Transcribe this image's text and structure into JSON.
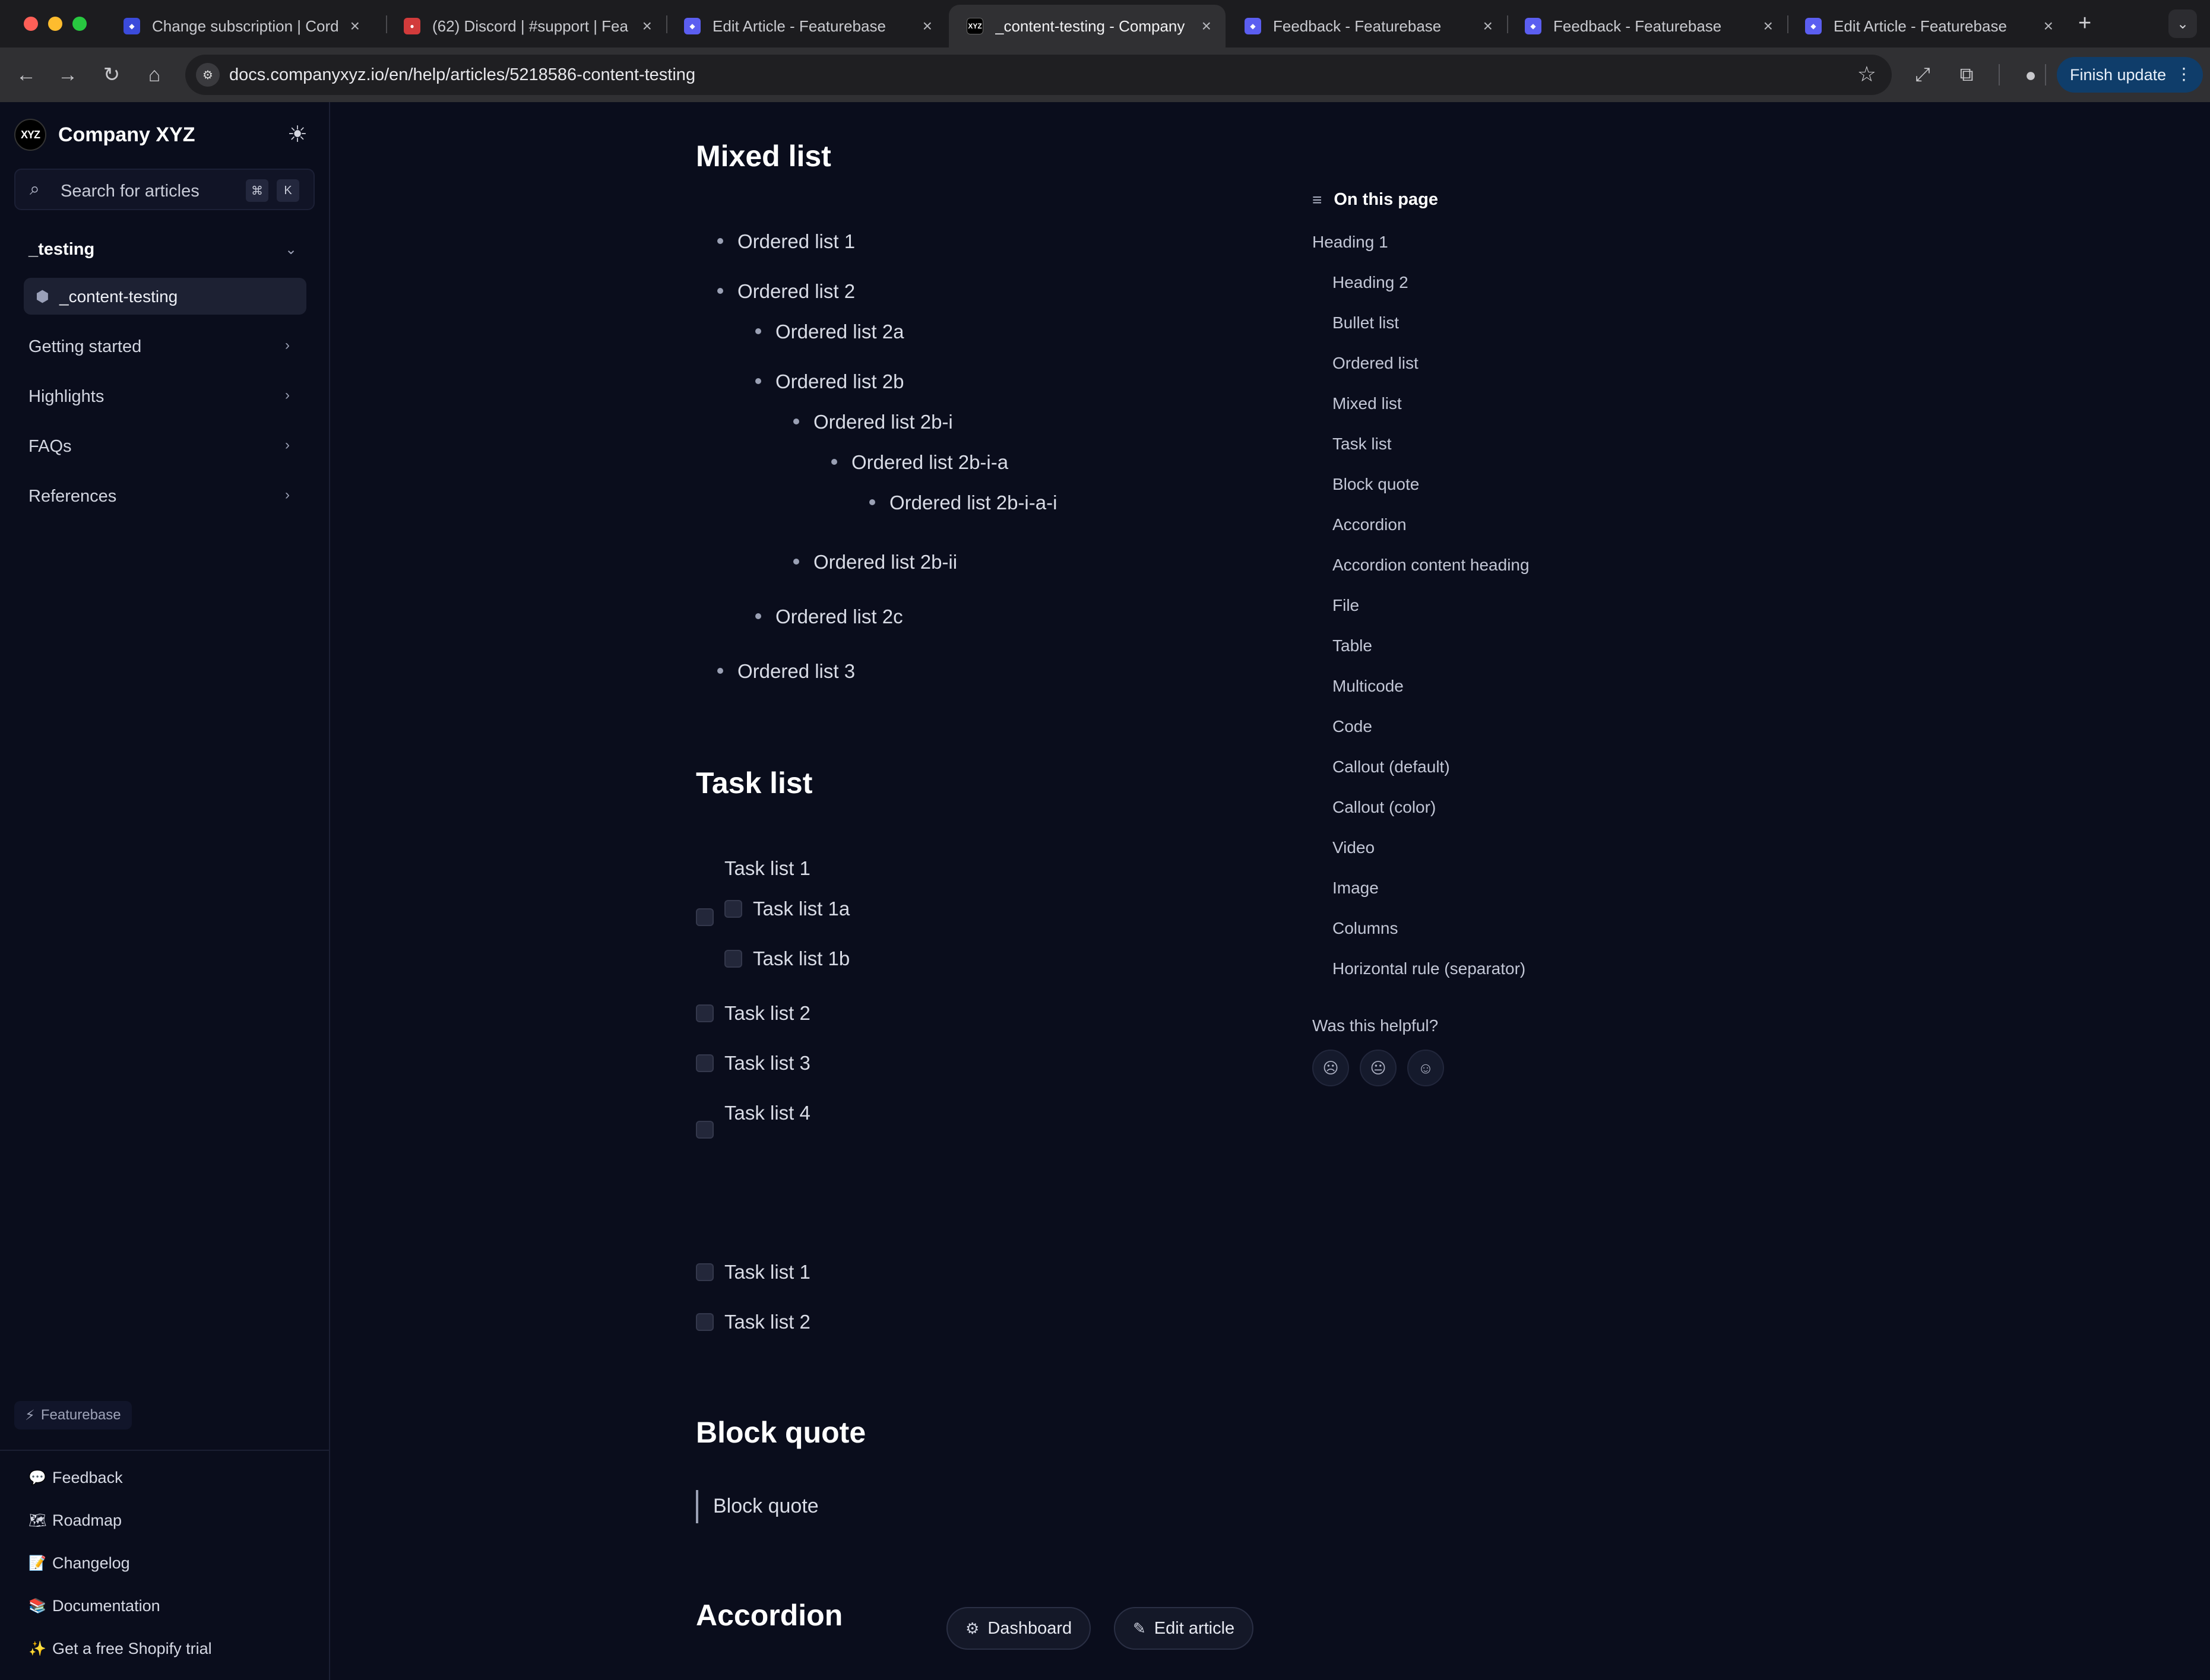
{
  "browser": {
    "tabs": [
      {
        "title": "Change subscription | Cordne",
        "fav_color": "#3b4bdb"
      },
      {
        "title": "(62) Discord | #support | Fea",
        "fav_color": "#d23b3b"
      },
      {
        "title": "Edit Article - Featurebase",
        "fav_color": "#5b5ef0"
      },
      {
        "title": "_content-testing - Company",
        "fav_color": "#000000"
      },
      {
        "title": "Feedback - Featurebase",
        "fav_color": "#5b5ef0"
      },
      {
        "title": "Feedback - Featurebase",
        "fav_color": "#5b5ef0"
      },
      {
        "title": "Edit Article - Featurebase",
        "fav_color": "#5b5ef0"
      }
    ],
    "active_tab_index": 3,
    "url": "docs.companyxyz.io/en/help/articles/5218586-content-testing",
    "finish_update_label": "Finish update",
    "icons": {
      "back": "back-arrow-icon",
      "forward": "forward-arrow-icon",
      "reload": "reload-icon",
      "home": "home-icon",
      "bookmark": "star-icon"
    }
  },
  "sidebar": {
    "brand_logo_text": "XYZ",
    "brand_name": "Company XYZ",
    "search_placeholder": "Search for articles",
    "search_key_cmd": "⌘",
    "search_key_k": "K",
    "section_open": "_testing",
    "active_item": "_content-testing",
    "sections": [
      "Getting started",
      "Highlights",
      "FAQs",
      "References"
    ],
    "powered_by": "Featurebase",
    "links": [
      {
        "label": "Feedback",
        "icon": "💬"
      },
      {
        "label": "Roadmap",
        "icon": "🗺"
      },
      {
        "label": "Changelog",
        "icon": "📝"
      },
      {
        "label": "Documentation",
        "icon": "📚"
      },
      {
        "label": "Get a free Shopify trial",
        "icon": "✨"
      }
    ]
  },
  "content": {
    "mixed_list": {
      "heading": "Mixed list",
      "items": [
        "Ordered list 1",
        "Ordered list 2",
        "Ordered list 2a",
        "Ordered list 2b",
        "Ordered list 2b-i",
        "Ordered list 2b-i-a",
        "Ordered list 2b-i-a-i",
        "Ordered list 2b-ii",
        "Ordered list 2c",
        "Ordered list 3"
      ]
    },
    "task_list": {
      "heading": "Task list",
      "items": [
        "Task list 1",
        "Task list 1a",
        "Task list 1b",
        "Task list 2",
        "Task list 3",
        "Task list 4",
        "Task list 1",
        "Task list 2"
      ]
    },
    "block_quote": {
      "heading": "Block quote",
      "text": "Block quote"
    },
    "accordion": {
      "heading": "Accordion"
    },
    "floating_buttons": {
      "dashboard": "Dashboard",
      "edit_article": "Edit article"
    }
  },
  "toc": {
    "title": "On this page",
    "items": [
      "Heading 1",
      "Heading 2",
      "Bullet list",
      "Ordered list",
      "Mixed list",
      "Task list",
      "Block quote",
      "Accordion",
      "Accordion content heading",
      "File",
      "Table",
      "Multicode",
      "Code",
      "Callout (default)",
      "Callout (color)",
      "Video",
      "Image",
      "Columns",
      "Horizontal rule (separator)"
    ],
    "helpful_question": "Was this helpful?"
  }
}
